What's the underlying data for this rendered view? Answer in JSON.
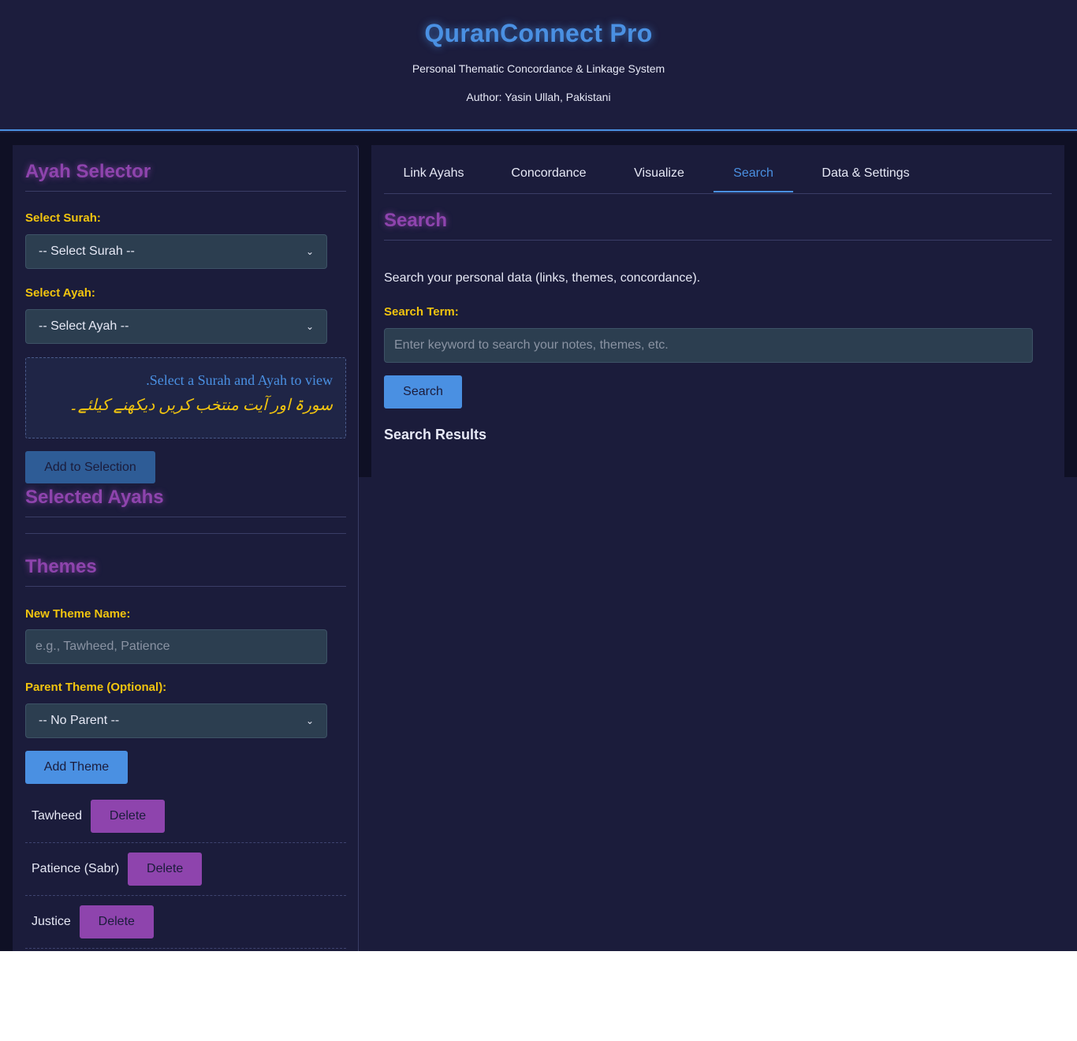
{
  "header": {
    "title": "QuranConnect Pro",
    "subtitle": "Personal Thematic Concordance & Linkage System",
    "author": "Author: Yasin Ullah, Pakistani"
  },
  "ayah_selector": {
    "title": "Ayah Selector",
    "surah_label": "Select Surah:",
    "surah_value": "-- Select Surah --",
    "ayah_label": "Select Ayah:",
    "ayah_value": "-- Select Ayah --",
    "preview_en": "Select a Surah and Ayah to view.",
    "preview_ur": "سورۃ اور آیت منتخب کریں دیکھنے کیلئے۔",
    "add_button": "Add to Selection"
  },
  "selected_ayahs": {
    "title": "Selected Ayahs"
  },
  "themes": {
    "title": "Themes",
    "new_label": "New Theme Name:",
    "new_placeholder": "e.g., Tawheed, Patience",
    "parent_label": "Parent Theme (Optional):",
    "parent_value": "-- No Parent --",
    "add_button": "Add Theme",
    "delete_label": "Delete",
    "items": [
      {
        "name": "Tawheed"
      },
      {
        "name": "Patience (Sabr)"
      },
      {
        "name": "Justice"
      }
    ]
  },
  "tabs": [
    {
      "label": "Link Ayahs"
    },
    {
      "label": "Concordance"
    },
    {
      "label": "Visualize"
    },
    {
      "label": "Search"
    },
    {
      "label": "Data & Settings"
    }
  ],
  "active_tab": "Search",
  "search": {
    "title": "Search",
    "description": "Search your personal data (links, themes, concordance).",
    "term_label": "Search Term:",
    "placeholder": "Enter keyword to search your notes, themes, etc.",
    "button": "Search",
    "results_title": "Search Results"
  },
  "colors": {
    "accent": "#4a90e2",
    "heading": "#8e44ad",
    "label": "#f1c40f",
    "background": "#1b1c3b"
  }
}
